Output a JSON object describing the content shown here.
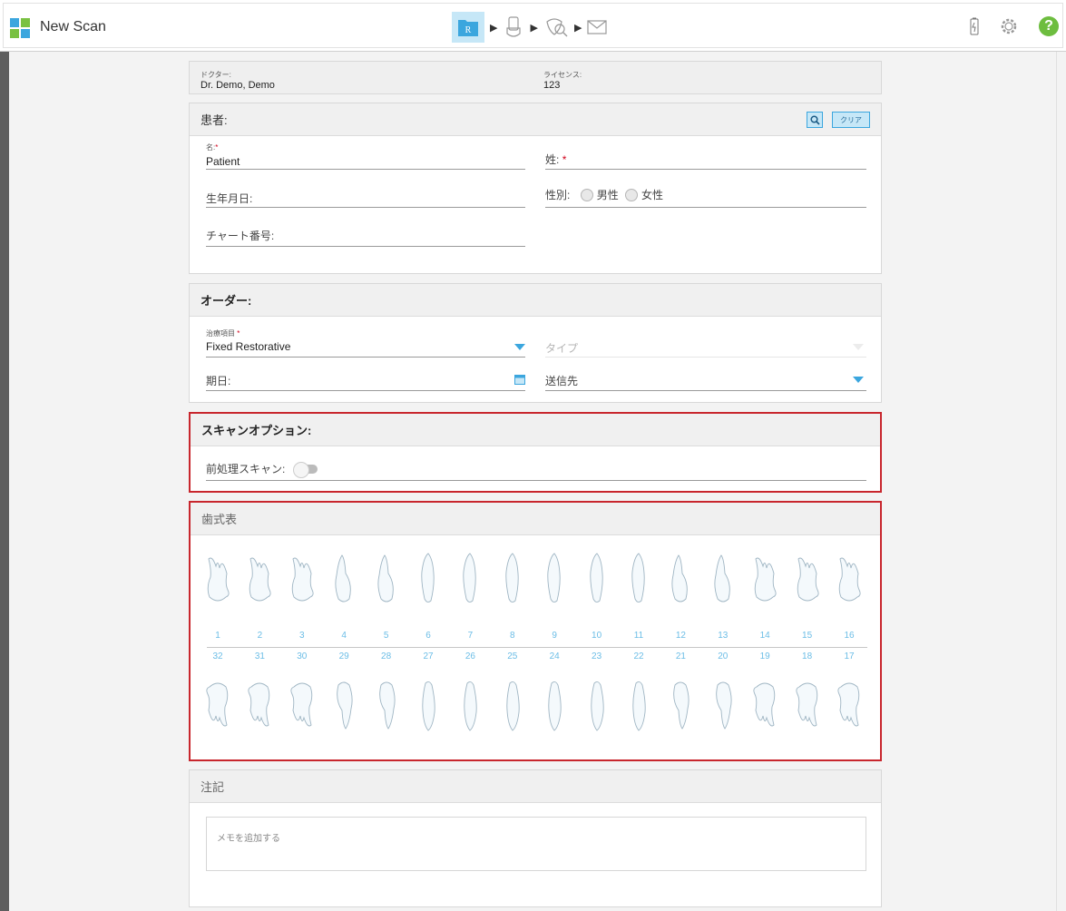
{
  "app": {
    "title": "New Scan"
  },
  "colors": {
    "accent": "#3ba6de",
    "accent_light": "#c6e7f7",
    "required": "#d0021b",
    "flag_border": "#c8262d",
    "help": "#6dbd3f",
    "logo": [
      "#3ba6de",
      "#79c142",
      "#79c142",
      "#3ba6de"
    ]
  },
  "workflow": {
    "steps": [
      "rx-icon",
      "scan-icon",
      "view-icon",
      "send-icon"
    ],
    "rx_letter": "R"
  },
  "doctor": {
    "label": "ドクター:",
    "value": "Dr. Demo, Demo"
  },
  "license": {
    "label": "ライセンス:",
    "value": "123"
  },
  "patient": {
    "header": "患者:",
    "clear_label": "クリア",
    "first_name_label": "名:",
    "first_name_value": "Patient",
    "last_name_label": "姓:",
    "dob_label": "生年月日:",
    "gender_label": "性別:",
    "gender_male": "男性",
    "gender_female": "女性",
    "chart_label": "チャート番号:"
  },
  "order": {
    "header": "オーダー:",
    "procedure_label": "治療項目",
    "procedure_value": "Fixed Restorative",
    "type_placeholder": "タイプ",
    "due_date_label": "期日:",
    "send_to_label": "送信先"
  },
  "scan_options": {
    "header": "スキャンオプション:",
    "prep_scan_label": "前処理スキャン:",
    "prep_scan_on": false
  },
  "tooth_chart": {
    "header": "歯式表",
    "upper": [
      "1",
      "2",
      "3",
      "4",
      "5",
      "6",
      "7",
      "8",
      "9",
      "10",
      "11",
      "12",
      "13",
      "14",
      "15",
      "16"
    ],
    "lower": [
      "32",
      "31",
      "30",
      "29",
      "28",
      "27",
      "26",
      "25",
      "24",
      "23",
      "22",
      "21",
      "20",
      "19",
      "18",
      "17"
    ]
  },
  "notes": {
    "header": "注記",
    "placeholder": "メモを追加する"
  }
}
